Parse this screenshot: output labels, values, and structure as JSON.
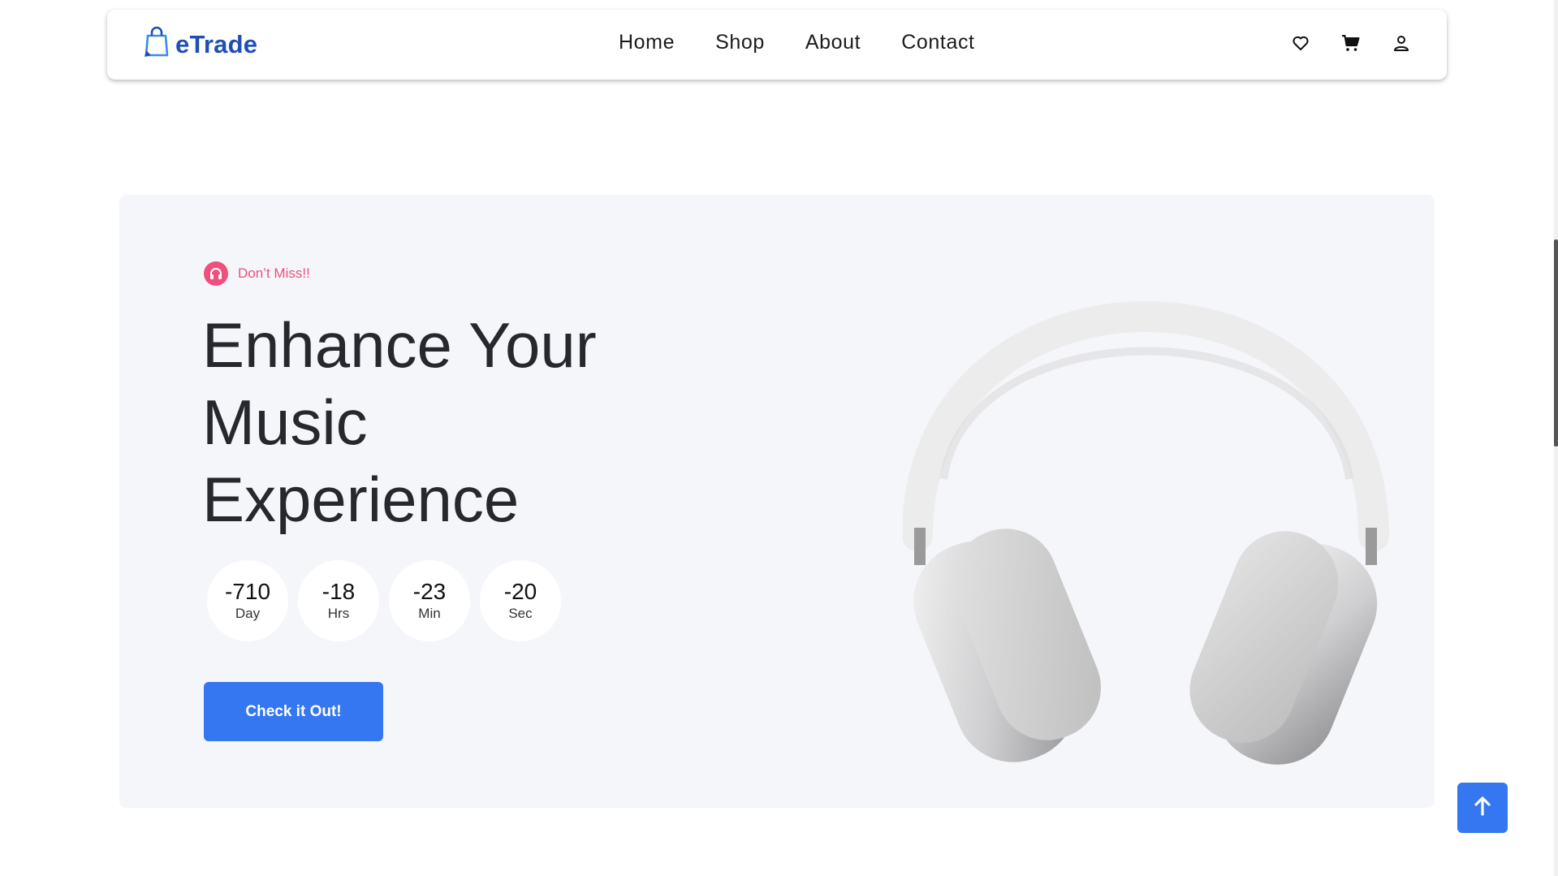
{
  "header": {
    "logo_text": "eTrade",
    "nav": [
      {
        "label": "Home"
      },
      {
        "label": "Shop"
      },
      {
        "label": "About"
      },
      {
        "label": "Contact"
      }
    ],
    "actions": [
      "heart-icon",
      "cart-icon",
      "user-icon"
    ]
  },
  "hero": {
    "tag": "Don’t Miss!!",
    "title": "Enhance Your Music Experience",
    "countdown": [
      {
        "value": "-710",
        "label": "Day"
      },
      {
        "value": "-18",
        "label": "Hrs"
      },
      {
        "value": "-23",
        "label": "Min"
      },
      {
        "value": "-20",
        "label": "Sec"
      }
    ],
    "cta_label": "Check it Out!",
    "product_image": "headphones"
  },
  "colors": {
    "accent": "#3577f0",
    "tag": "#ef4f7d",
    "logo": "#1f4fb5",
    "hero_bg": "#f5f6fa"
  }
}
